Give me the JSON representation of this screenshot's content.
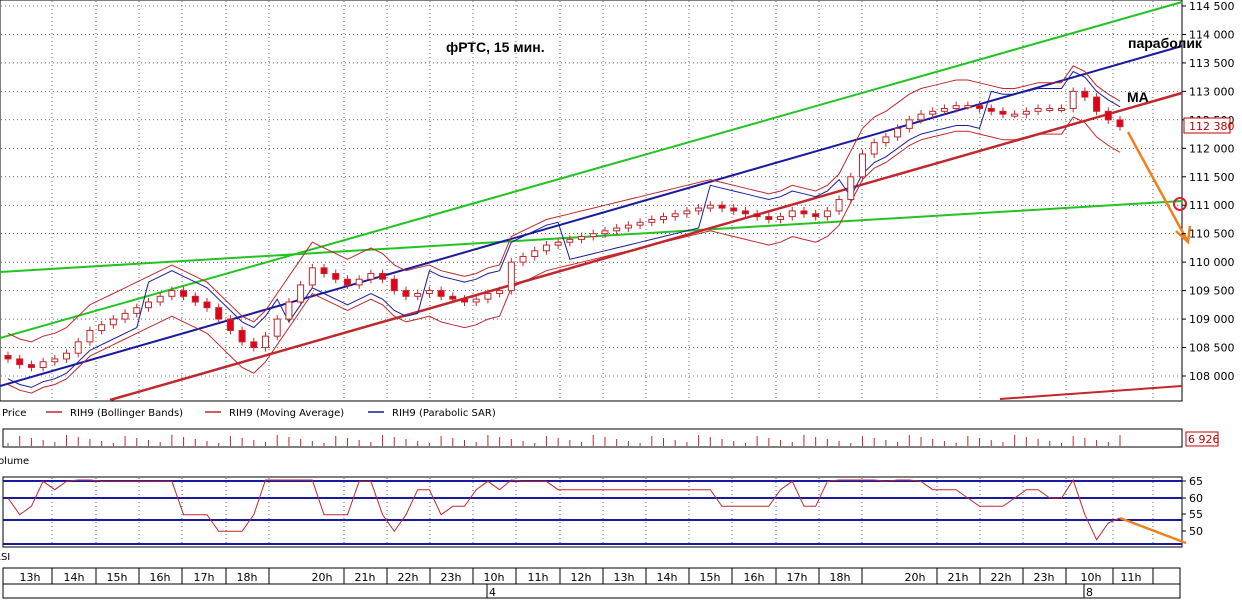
{
  "chart_data": {
    "type": "candlestick",
    "title": "фРТС,  15 мин.",
    "price_axis": {
      "ticks": [
        "114 500",
        "114 000",
        "113 500",
        "113 000",
        "112 500",
        "112 000",
        "111 500",
        "111 000",
        "110 500",
        "110 000",
        "109 500",
        "109 000",
        "108 500",
        "108 000"
      ],
      "ylim": [
        107600,
        114550
      ]
    },
    "last_price_label": "112 380",
    "volume_label": "6 926",
    "rsi_axis": {
      "ticks": [
        "65",
        "60",
        "55",
        "50"
      ]
    },
    "legend": [
      "Price",
      "RIH9 (Bollinger Bands)",
      "RIH9 (Moving Average)",
      "RIH9 (Parabolic SAR)"
    ],
    "volume_title": "Volume",
    "rsi_title": "RSI",
    "time_axis": {
      "labels": [
        "13h",
        "14h",
        "15h",
        "16h",
        "17h",
        "18h",
        "20h",
        "21h",
        "22h",
        "23h",
        "10h",
        "11h",
        "12h",
        "13h",
        "14h",
        "15h",
        "16h",
        "17h",
        "18h",
        "20h",
        "21h",
        "22h",
        "23h",
        "10h",
        "11h"
      ],
      "day_labels": [
        {
          "label": "4",
          "at_index": 10
        },
        {
          "label": "8",
          "at_index": 23
        }
      ]
    },
    "annotations": [
      "параболик",
      "MA"
    ],
    "close_prices": [
      108300,
      108200,
      108150,
      108250,
      108300,
      108400,
      108600,
      108800,
      108900,
      109000,
      109100,
      109200,
      109300,
      109400,
      109500,
      109400,
      109300,
      109200,
      109000,
      108800,
      108600,
      108500,
      108700,
      109000,
      109300,
      109600,
      109900,
      109800,
      109700,
      109600,
      109700,
      109800,
      109700,
      109500,
      109400,
      109450,
      109500,
      109400,
      109350,
      109300,
      109350,
      109450,
      109500,
      110000,
      110100,
      110200,
      110300,
      110350,
      110400,
      110450,
      110500,
      110550,
      110600,
      110650,
      110700,
      110750,
      110800,
      110850,
      110900,
      110950,
      111000,
      110950,
      110900,
      110850,
      110800,
      110750,
      110800,
      110900,
      110850,
      110800,
      110900,
      111100,
      111500,
      111900,
      112100,
      112200,
      112350,
      112500,
      112600,
      112650,
      112700,
      112750,
      112750,
      112700,
      112650,
      112600,
      112600,
      112650,
      112700,
      112700,
      112700,
      113000,
      112900,
      112650,
      112500,
      112380
    ]
  }
}
